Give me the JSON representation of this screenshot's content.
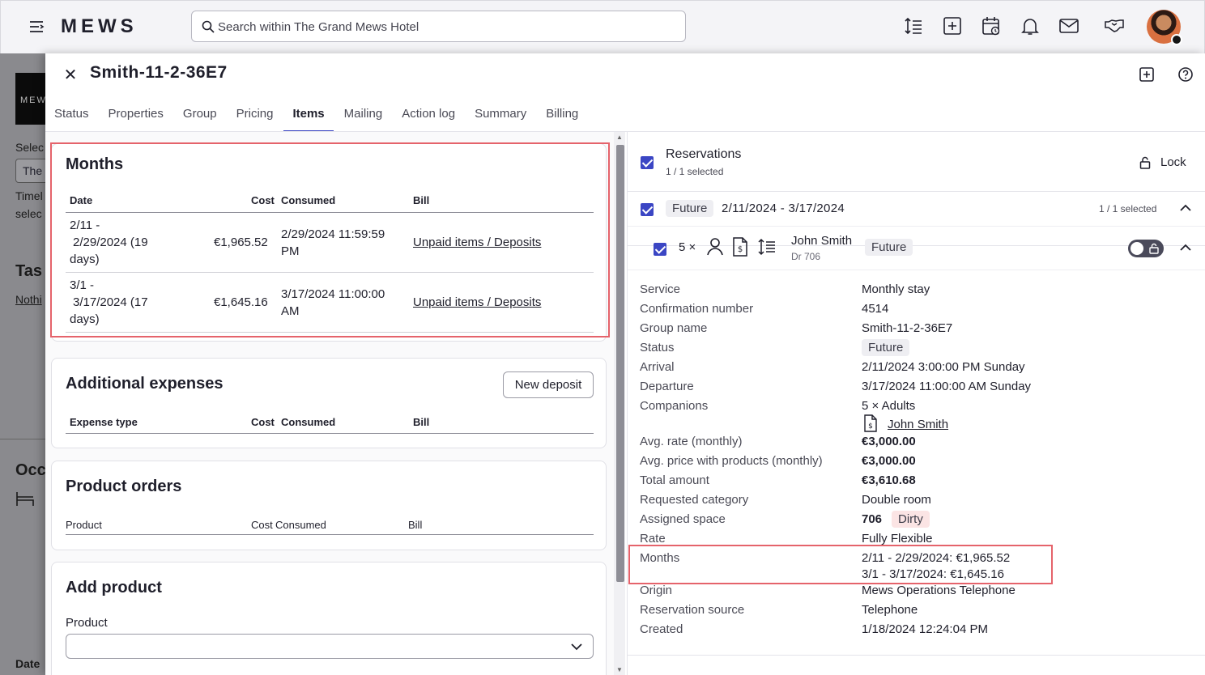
{
  "topbar": {
    "logo": "MEWS",
    "search_placeholder": "Search within The Grand Mews Hotel"
  },
  "background": {
    "logo_text": "MEW",
    "select_label": "Selec",
    "select_value": "The",
    "timeline": "Timel",
    "select2": "selec",
    "tasks_title": "Tas",
    "nothing": "Nothi",
    "occupancy": "Occ",
    "date_label": "Date"
  },
  "panel": {
    "title": "Smith-11-2-36E7",
    "tabs": [
      "Status",
      "Properties",
      "Group",
      "Pricing",
      "Items",
      "Mailing",
      "Action log",
      "Summary",
      "Billing"
    ],
    "active_tab": "Items"
  },
  "months": {
    "title": "Months",
    "headers": {
      "date": "Date",
      "cost": "Cost",
      "consumed": "Consumed",
      "bill": "Bill"
    },
    "rows": [
      {
        "date_l1": "2/11 -",
        "date_l2": "2/29/2024 (19",
        "date_l3": "days)",
        "cost": "€1,965.52",
        "consumed_l1": "2/29/2024 11:59:59",
        "consumed_l2": "PM",
        "bill": "Unpaid items / Deposits"
      },
      {
        "date_l1": "3/1 -",
        "date_l2": "3/17/2024 (17",
        "date_l3": "days)",
        "cost": "€1,645.16",
        "consumed_l1": "3/17/2024 11:00:00",
        "consumed_l2": "AM",
        "bill": "Unpaid items / Deposits"
      }
    ]
  },
  "additional_expenses": {
    "title": "Additional expenses",
    "new_deposit": "New deposit",
    "headers": {
      "type": "Expense type",
      "cost": "Cost",
      "consumed": "Consumed",
      "bill": "Bill"
    }
  },
  "product_orders": {
    "title": "Product orders",
    "headers": {
      "product": "Product",
      "cost": "Cost",
      "consumed": "Consumed",
      "bill": "Bill"
    }
  },
  "add_product": {
    "title": "Add product",
    "product_label": "Product",
    "product_value": ""
  },
  "reservations": {
    "title": "Reservations",
    "selected": "1 / 1 selected",
    "lock": "Lock",
    "group_badge": "Future",
    "group_dates": "2/11/2024 - 3/17/2024",
    "group_selected": "1 / 1 selected",
    "res_count": "5 ×",
    "guest_name": "John Smith",
    "room": "Dr 706",
    "res_badge": "Future"
  },
  "details": {
    "service": {
      "label": "Service",
      "value": "Monthly stay"
    },
    "confirmation": {
      "label": "Confirmation number",
      "value": "4514"
    },
    "group_name": {
      "label": "Group name",
      "value": "Smith-11-2-36E7"
    },
    "status": {
      "label": "Status",
      "value": "Future"
    },
    "arrival": {
      "label": "Arrival",
      "value": "2/11/2024 3:00:00 PM Sunday"
    },
    "departure": {
      "label": "Departure",
      "value": "3/17/2024 11:00:00 AM Sunday"
    },
    "companions": {
      "label": "Companions",
      "value": "5 × Adults",
      "guest": "John Smith"
    },
    "avg_rate": {
      "label": "Avg. rate (monthly)",
      "value": "€3,000.00"
    },
    "avg_price": {
      "label": "Avg. price with products (monthly)",
      "value": "€3,000.00"
    },
    "total": {
      "label": "Total amount",
      "value": "€3,610.68"
    },
    "requested": {
      "label": "Requested category",
      "value": "Double room"
    },
    "assigned": {
      "label": "Assigned space",
      "value": "706",
      "badge": "Dirty"
    },
    "rate": {
      "label": "Rate",
      "value": "Fully Flexible"
    },
    "months": {
      "label": "Months",
      "value_1": "2/11 - 2/29/2024: €1,965.52",
      "value_2": "3/1 - 3/17/2024: €1,645.16"
    },
    "origin": {
      "label": "Origin",
      "value": "Mews Operations Telephone"
    },
    "source": {
      "label": "Reservation source",
      "value": "Telephone"
    },
    "created": {
      "label": "Created",
      "value": "1/18/2024 12:24:04 PM"
    }
  }
}
